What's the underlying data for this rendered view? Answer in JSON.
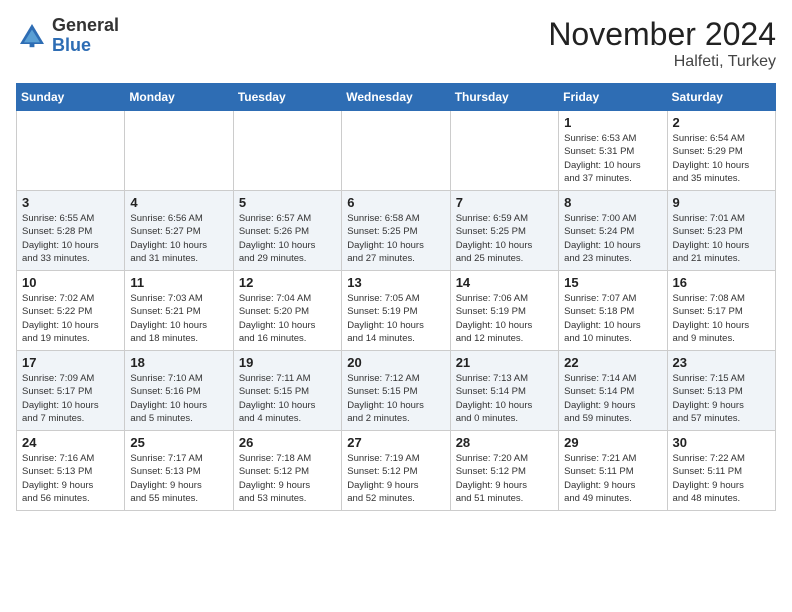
{
  "logo": {
    "general": "General",
    "blue": "Blue"
  },
  "title": "November 2024",
  "location": "Halfeti, Turkey",
  "days_of_week": [
    "Sunday",
    "Monday",
    "Tuesday",
    "Wednesday",
    "Thursday",
    "Friday",
    "Saturday"
  ],
  "weeks": [
    [
      {
        "day": "",
        "info": ""
      },
      {
        "day": "",
        "info": ""
      },
      {
        "day": "",
        "info": ""
      },
      {
        "day": "",
        "info": ""
      },
      {
        "day": "",
        "info": ""
      },
      {
        "day": "1",
        "info": "Sunrise: 6:53 AM\nSunset: 5:31 PM\nDaylight: 10 hours\nand 37 minutes."
      },
      {
        "day": "2",
        "info": "Sunrise: 6:54 AM\nSunset: 5:29 PM\nDaylight: 10 hours\nand 35 minutes."
      }
    ],
    [
      {
        "day": "3",
        "info": "Sunrise: 6:55 AM\nSunset: 5:28 PM\nDaylight: 10 hours\nand 33 minutes."
      },
      {
        "day": "4",
        "info": "Sunrise: 6:56 AM\nSunset: 5:27 PM\nDaylight: 10 hours\nand 31 minutes."
      },
      {
        "day": "5",
        "info": "Sunrise: 6:57 AM\nSunset: 5:26 PM\nDaylight: 10 hours\nand 29 minutes."
      },
      {
        "day": "6",
        "info": "Sunrise: 6:58 AM\nSunset: 5:25 PM\nDaylight: 10 hours\nand 27 minutes."
      },
      {
        "day": "7",
        "info": "Sunrise: 6:59 AM\nSunset: 5:25 PM\nDaylight: 10 hours\nand 25 minutes."
      },
      {
        "day": "8",
        "info": "Sunrise: 7:00 AM\nSunset: 5:24 PM\nDaylight: 10 hours\nand 23 minutes."
      },
      {
        "day": "9",
        "info": "Sunrise: 7:01 AM\nSunset: 5:23 PM\nDaylight: 10 hours\nand 21 minutes."
      }
    ],
    [
      {
        "day": "10",
        "info": "Sunrise: 7:02 AM\nSunset: 5:22 PM\nDaylight: 10 hours\nand 19 minutes."
      },
      {
        "day": "11",
        "info": "Sunrise: 7:03 AM\nSunset: 5:21 PM\nDaylight: 10 hours\nand 18 minutes."
      },
      {
        "day": "12",
        "info": "Sunrise: 7:04 AM\nSunset: 5:20 PM\nDaylight: 10 hours\nand 16 minutes."
      },
      {
        "day": "13",
        "info": "Sunrise: 7:05 AM\nSunset: 5:19 PM\nDaylight: 10 hours\nand 14 minutes."
      },
      {
        "day": "14",
        "info": "Sunrise: 7:06 AM\nSunset: 5:19 PM\nDaylight: 10 hours\nand 12 minutes."
      },
      {
        "day": "15",
        "info": "Sunrise: 7:07 AM\nSunset: 5:18 PM\nDaylight: 10 hours\nand 10 minutes."
      },
      {
        "day": "16",
        "info": "Sunrise: 7:08 AM\nSunset: 5:17 PM\nDaylight: 10 hours\nand 9 minutes."
      }
    ],
    [
      {
        "day": "17",
        "info": "Sunrise: 7:09 AM\nSunset: 5:17 PM\nDaylight: 10 hours\nand 7 minutes."
      },
      {
        "day": "18",
        "info": "Sunrise: 7:10 AM\nSunset: 5:16 PM\nDaylight: 10 hours\nand 5 minutes."
      },
      {
        "day": "19",
        "info": "Sunrise: 7:11 AM\nSunset: 5:15 PM\nDaylight: 10 hours\nand 4 minutes."
      },
      {
        "day": "20",
        "info": "Sunrise: 7:12 AM\nSunset: 5:15 PM\nDaylight: 10 hours\nand 2 minutes."
      },
      {
        "day": "21",
        "info": "Sunrise: 7:13 AM\nSunset: 5:14 PM\nDaylight: 10 hours\nand 0 minutes."
      },
      {
        "day": "22",
        "info": "Sunrise: 7:14 AM\nSunset: 5:14 PM\nDaylight: 9 hours\nand 59 minutes."
      },
      {
        "day": "23",
        "info": "Sunrise: 7:15 AM\nSunset: 5:13 PM\nDaylight: 9 hours\nand 57 minutes."
      }
    ],
    [
      {
        "day": "24",
        "info": "Sunrise: 7:16 AM\nSunset: 5:13 PM\nDaylight: 9 hours\nand 56 minutes."
      },
      {
        "day": "25",
        "info": "Sunrise: 7:17 AM\nSunset: 5:13 PM\nDaylight: 9 hours\nand 55 minutes."
      },
      {
        "day": "26",
        "info": "Sunrise: 7:18 AM\nSunset: 5:12 PM\nDaylight: 9 hours\nand 53 minutes."
      },
      {
        "day": "27",
        "info": "Sunrise: 7:19 AM\nSunset: 5:12 PM\nDaylight: 9 hours\nand 52 minutes."
      },
      {
        "day": "28",
        "info": "Sunrise: 7:20 AM\nSunset: 5:12 PM\nDaylight: 9 hours\nand 51 minutes."
      },
      {
        "day": "29",
        "info": "Sunrise: 7:21 AM\nSunset: 5:11 PM\nDaylight: 9 hours\nand 49 minutes."
      },
      {
        "day": "30",
        "info": "Sunrise: 7:22 AM\nSunset: 5:11 PM\nDaylight: 9 hours\nand 48 minutes."
      }
    ]
  ]
}
